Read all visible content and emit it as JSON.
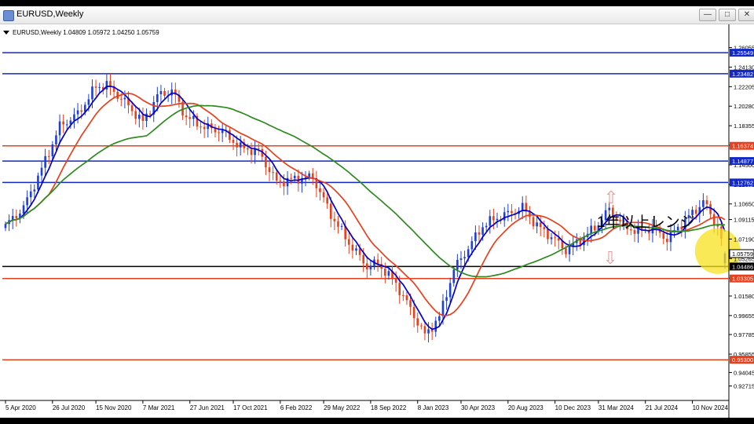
{
  "window": {
    "title": "EURUSD,Weekly",
    "min_label": "—",
    "max_label": "□",
    "close_label": "✕"
  },
  "colors": {
    "ma_fast": "#0000cc",
    "ma_mid": "#e8401c",
    "ma_slow": "#2d8a1f",
    "bull_candle": "#1e3fd8",
    "bear_candle": "#e8401c",
    "highlight": "#f7e11e",
    "arrow": "#e89a9a"
  },
  "chart_data": {
    "type": "candlestick",
    "header": "EURUSD,Weekly  1.04809 1.05972 1.04250 1.05759",
    "ylim": [
      0.9137,
      1.2695
    ],
    "y_ticks": [
      1.26055,
      1.2413,
      1.22205,
      1.2028,
      1.18355,
      1.16425,
      1.145,
      1.12575,
      1.1065,
      1.09115,
      1.0719,
      1.05265,
      1.0334,
      1.0158,
      0.99655,
      0.97785,
      0.95855,
      0.94045,
      0.92715
    ],
    "x_ticks": [
      "5 Apr 2020",
      "26 Jul 2020",
      "15 Nov 2020",
      "7 Mar 2021",
      "27 Jun 2021",
      "17 Oct 2021",
      "6 Feb 2022",
      "29 May 2022",
      "18 Sep 2022",
      "8 Jan 2023",
      "30 Apr 2023",
      "20 Aug 2023",
      "10 Dec 2023",
      "31 Mar 2024",
      "21 Jul 2024",
      "10 Nov 2024"
    ],
    "price_key": [
      [
        0,
        1.085
      ],
      [
        5,
        1.103
      ],
      [
        10,
        1.141
      ],
      [
        15,
        1.183
      ],
      [
        20,
        1.195
      ],
      [
        25,
        1.222
      ],
      [
        28,
        1.224
      ],
      [
        33,
        1.207
      ],
      [
        38,
        1.187
      ],
      [
        42,
        1.213
      ],
      [
        46,
        1.218
      ],
      [
        50,
        1.192
      ],
      [
        55,
        1.182
      ],
      [
        60,
        1.178
      ],
      [
        65,
        1.162
      ],
      [
        70,
        1.158
      ],
      [
        75,
        1.128
      ],
      [
        80,
        1.131
      ],
      [
        85,
        1.133
      ],
      [
        90,
        1.096
      ],
      [
        95,
        1.068
      ],
      [
        100,
        1.045
      ],
      [
        103,
        1.048
      ],
      [
        108,
        1.028
      ],
      [
        112,
        1.003
      ],
      [
        116,
        0.977
      ],
      [
        120,
        0.995
      ],
      [
        124,
        1.042
      ],
      [
        128,
        1.063
      ],
      [
        132,
        1.085
      ],
      [
        136,
        1.093
      ],
      [
        140,
        1.098
      ],
      [
        143,
        1.103
      ],
      [
        147,
        1.085
      ],
      [
        151,
        1.074
      ],
      [
        155,
        1.061
      ],
      [
        159,
        1.071
      ],
      [
        163,
        1.083
      ],
      [
        167,
        1.101
      ],
      [
        171,
        1.085
      ],
      [
        175,
        1.079
      ],
      [
        179,
        1.083
      ],
      [
        183,
        1.072
      ],
      [
        187,
        1.087
      ],
      [
        191,
        1.101
      ],
      [
        193,
        1.109
      ],
      [
        197,
        1.084
      ],
      [
        199,
        1.0576
      ]
    ],
    "ohlc": [],
    "latest": {
      "open": 1.04809,
      "high": 1.05972,
      "low": 1.0425,
      "close": 1.05759
    },
    "moving_averages": [
      {
        "color": "#0000cc",
        "period": 5
      },
      {
        "color": "#e8401c",
        "period": 13
      },
      {
        "color": "#2d8a1f",
        "period": 40
      }
    ],
    "hlines": [
      {
        "price": 1.25549,
        "color": "#1228c8",
        "label": "1.25549"
      },
      {
        "price": 1.23482,
        "color": "#1228c8",
        "label": "1.23482"
      },
      {
        "price": 1.16374,
        "color": "#e8401c",
        "label": "1.16374"
      },
      {
        "price": 1.14877,
        "color": "#1228c8",
        "label": "1.14877"
      },
      {
        "price": 1.12762,
        "color": "#1228c8",
        "label": "1.12762"
      },
      {
        "price": 1.04486,
        "color": "#000000",
        "label": "1.04486"
      },
      {
        "price": 1.03305,
        "color": "#e8401c",
        "label": "1.03305"
      },
      {
        "price": 0.953,
        "color": "#e8401c",
        "label": "0.95300"
      }
    ],
    "current_price_label": "1.05759",
    "annotation": "1年以上レンジ",
    "arrow_up": "⇧",
    "arrow_down": "⇩",
    "grid": false
  }
}
